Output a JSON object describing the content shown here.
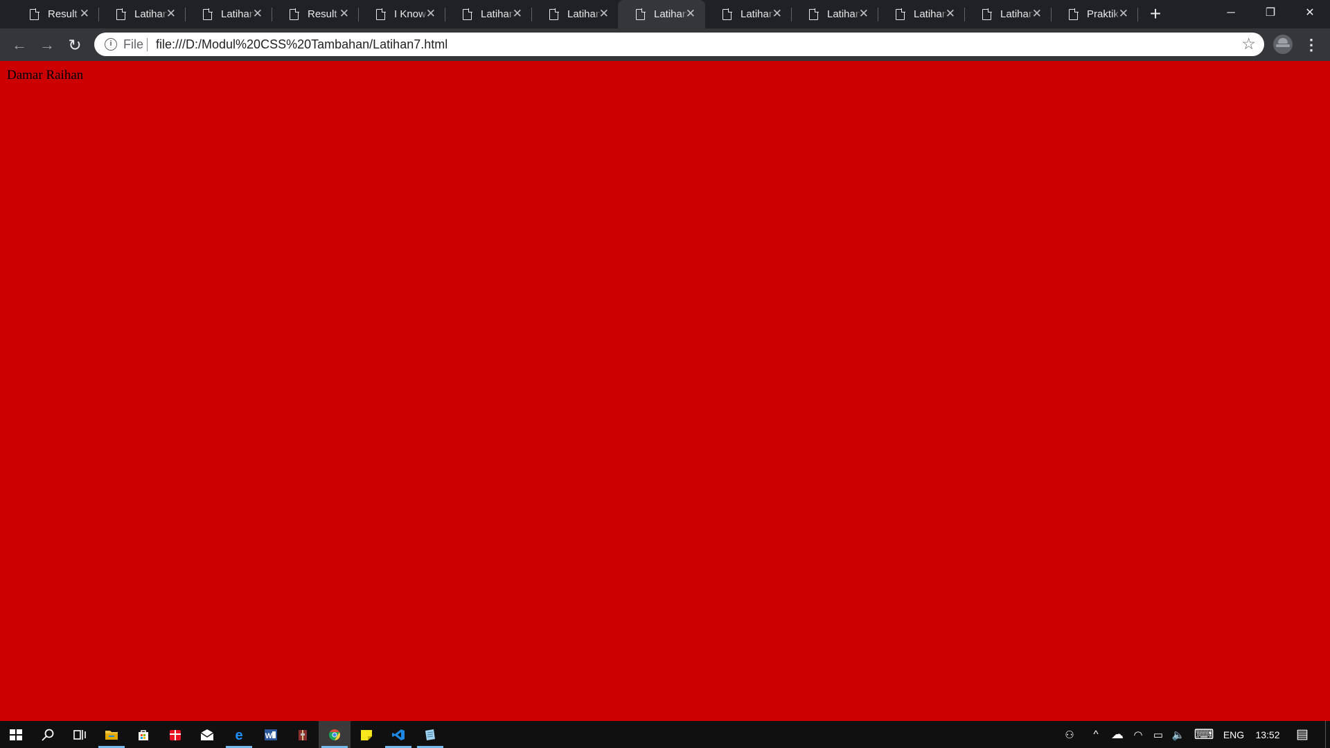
{
  "browser": {
    "tabs": [
      {
        "label": "Result",
        "active": false
      },
      {
        "label": "Latihan",
        "active": false
      },
      {
        "label": "Latihan",
        "active": false
      },
      {
        "label": "Result",
        "active": false
      },
      {
        "label": "I Know",
        "active": false
      },
      {
        "label": "Latihan",
        "active": false
      },
      {
        "label": "Latihan",
        "active": false
      },
      {
        "label": "Latihan",
        "active": true
      },
      {
        "label": "Latihan",
        "active": false
      },
      {
        "label": "Latihan",
        "active": false
      },
      {
        "label": "Latihan",
        "active": false
      },
      {
        "label": "Latihan",
        "active": false
      },
      {
        "label": "Praktik",
        "active": false
      }
    ],
    "tab_close_glyph": "✕",
    "new_tab_glyph": "+",
    "window_controls": {
      "minimize": "─",
      "restore": "❐",
      "close": "✕"
    },
    "nav": {
      "back": "←",
      "forward": "→",
      "reload": "↻"
    },
    "omnibox": {
      "info_glyph": "i",
      "scheme_chip": "File",
      "url": "file:///D:/Modul%20CSS%20Tambahan/Latihan7.html",
      "star_glyph": "☆"
    },
    "menu_glyph": "⋮"
  },
  "page": {
    "background_color": "#cc0000",
    "body_text": "Damar Raihan"
  },
  "taskbar": {
    "apps": [
      {
        "name": "start-button",
        "icon": "windows-logo-icon",
        "color": "#ffffff",
        "active": false,
        "open": false
      },
      {
        "name": "search-button",
        "icon": "search-icon",
        "color": "#ffffff",
        "active": false,
        "open": false
      },
      {
        "name": "task-view-button",
        "icon": "task-view-icon",
        "color": "#ffffff",
        "active": false,
        "open": false
      },
      {
        "name": "file-explorer-app",
        "icon": "folder-icon",
        "color": "#f4c542",
        "active": false,
        "open": true
      },
      {
        "name": "store-app",
        "icon": "store-bag-icon",
        "color": "#ffffff",
        "active": false,
        "open": false
      },
      {
        "name": "gift-app",
        "icon": "gift-icon",
        "color": "#e81123",
        "active": false,
        "open": false
      },
      {
        "name": "mail-app",
        "icon": "mail-icon",
        "color": "#ffffff",
        "active": false,
        "open": false
      },
      {
        "name": "edge-app",
        "icon": "edge-icon",
        "color": "#1e90ff",
        "active": false,
        "open": true
      },
      {
        "name": "word-app",
        "icon": "word-icon",
        "color": "#2b579a",
        "active": false,
        "open": false
      },
      {
        "name": "archive-app",
        "icon": "archive-icon",
        "color": "#8b2e2e",
        "active": false,
        "open": false
      },
      {
        "name": "chrome-app",
        "icon": "chrome-icon",
        "color": "#dd4b39",
        "active": true,
        "open": true
      },
      {
        "name": "sticky-notes-app",
        "icon": "sticky-note-icon",
        "color": "#f8e71c",
        "active": false,
        "open": false
      },
      {
        "name": "vscode-app",
        "icon": "vscode-icon",
        "color": "#1e88e5",
        "active": false,
        "open": true
      },
      {
        "name": "notepad-app",
        "icon": "notepad-icon",
        "color": "#9fd3f0",
        "active": false,
        "open": true
      }
    ],
    "tray": {
      "people_glyph": "⚇",
      "chevron_glyph": "^",
      "cloud_glyph": "☁",
      "wifi_glyph": "◠",
      "battery_glyph": "▭",
      "volume_glyph": "🔈",
      "keyboard_glyph": "⌨",
      "language": "ENG",
      "time": "13:52",
      "notification_glyph": "▤"
    }
  }
}
